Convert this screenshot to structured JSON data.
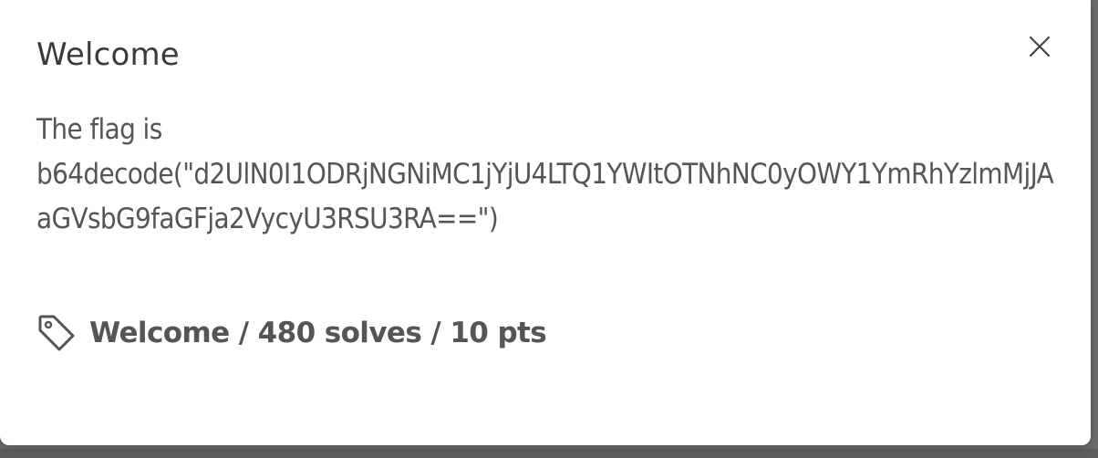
{
  "modal": {
    "title": "Welcome",
    "description_line1": "The flag is",
    "description_line2": "b64decode(\"d2UlN0I1ODRjNGNiMC1jYjU4LTQ1YWItOTNhNC0yOWY1YmRhYzlmMjJAaGVsbG9faGFja2VycyU3RSU3RA==\")",
    "meta": "Welcome / 480 solves / 10 pts",
    "icons": {
      "close": "close-icon",
      "tag": "tag-icon"
    }
  },
  "colors": {
    "text": "#555555",
    "title": "#3a3a3a",
    "background": "#ffffff"
  }
}
